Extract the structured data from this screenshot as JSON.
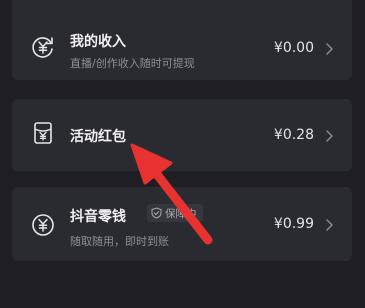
{
  "income": {
    "title": "我的收入",
    "subtitle": "直播/创作收入随时可提现",
    "amount": "¥0.00",
    "icon": "yuan-refresh-icon"
  },
  "hongbao": {
    "title": "活动红包",
    "amount": "¥0.28",
    "icon": "red-envelope-icon"
  },
  "wallet": {
    "title": "抖音零钱",
    "badge": "保障中",
    "subtitle": "随取随用，即时到账",
    "amount": "¥0.99",
    "icon": "yuan-coin-icon"
  },
  "annotation": {
    "color": "#e8322f"
  }
}
